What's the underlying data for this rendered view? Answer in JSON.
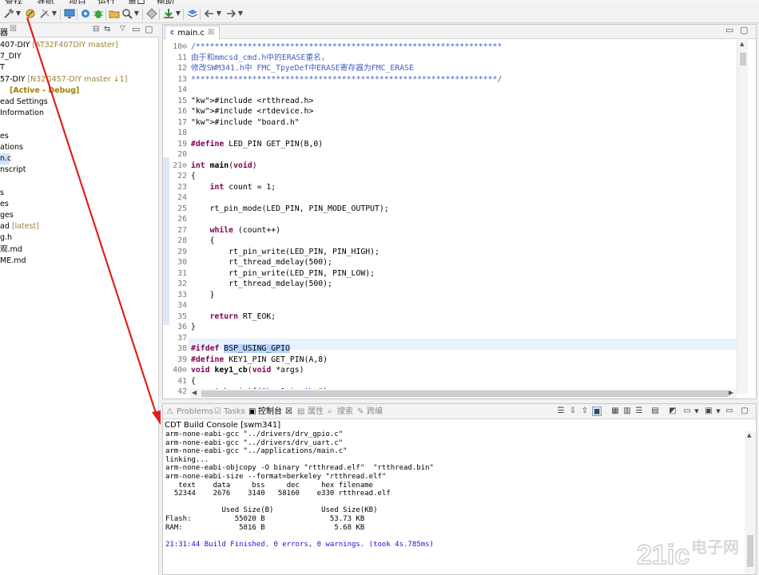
{
  "menubar": {
    "items": [
      "查找",
      "导航",
      "项目",
      "运行",
      "窗口",
      "帮助"
    ]
  },
  "toolbar": {
    "icons": [
      "hammer-icon",
      "build-icon",
      "tools-icon",
      "monitor-icon",
      "chip-icon",
      "bug-icon",
      "folder-icon",
      "search-icon",
      "diamond-icon",
      "download-icon",
      "layers-icon",
      "back-arrow-icon",
      "forward-arrow-icon"
    ]
  },
  "explorer": {
    "tab_label": "器",
    "rows": [
      {
        "text": "407-DIY",
        "extra": "[AT32F407DIY master]",
        "style": "dim"
      },
      {
        "text": "7_DIY",
        "extra": "",
        "style": ""
      },
      {
        "text": "T",
        "extra": "",
        "style": ""
      },
      {
        "text": "57-DIY",
        "extra": "[N32G457-DIY master ↓1]",
        "style": "dim"
      },
      {
        "text": "",
        "extra": "[Active - Debug]",
        "style": "green"
      },
      {
        "text": "ead Settings",
        "extra": "",
        "style": ""
      },
      {
        "text": "Information",
        "extra": "",
        "style": ""
      },
      {
        "text": "",
        "extra": "",
        "style": ""
      },
      {
        "text": "es",
        "extra": "",
        "style": ""
      },
      {
        "text": "ations",
        "extra": "",
        "style": ""
      },
      {
        "text": "n.c",
        "extra": "",
        "style": "sel"
      },
      {
        "text": "nscript",
        "extra": "",
        "style": ""
      },
      {
        "text": "",
        "extra": "",
        "style": ""
      },
      {
        "text": "s",
        "extra": "",
        "style": ""
      },
      {
        "text": "es",
        "extra": "",
        "style": ""
      },
      {
        "text": "ges",
        "extra": "",
        "style": ""
      },
      {
        "text": "ad",
        "extra": "[latest]",
        "style": "dim"
      },
      {
        "text": "g.h",
        "extra": "",
        "style": ""
      },
      {
        "text": "观.md",
        "extra": "",
        "style": ""
      },
      {
        "text": "ME.md",
        "extra": "",
        "style": ""
      }
    ]
  },
  "editor": {
    "tab_label": "main.c",
    "lines": [
      {
        "n": "10⊖",
        "code": "/*****************************************************************",
        "cls": "cm"
      },
      {
        "n": "11",
        "code": "由于和mmcsd_cmd.h中的ERASE重名，",
        "cls": "cm"
      },
      {
        "n": "12",
        "code": "修改SWM341.h中 FMC_TpyeDef中ERASE寄存器为FMC_ERASE",
        "cls": "cm"
      },
      {
        "n": "13",
        "code": "*****************************************************************/",
        "cls": "cm"
      },
      {
        "n": "14",
        "code": "",
        "cls": ""
      },
      {
        "n": "15",
        "code": "#include <rtthread.h>",
        "cls": "inc"
      },
      {
        "n": "16",
        "code": "#include <rtdevice.h>",
        "cls": "inc"
      },
      {
        "n": "17",
        "code": "#include \"board.h\"",
        "cls": "inc"
      },
      {
        "n": "18",
        "code": "",
        "cls": ""
      },
      {
        "n": "19",
        "code": "#define LED_PIN GET_PIN(B,0)",
        "cls": "def"
      },
      {
        "n": "20",
        "code": "",
        "cls": ""
      },
      {
        "n": "21⊖",
        "code": "int main(void)",
        "cls": "fn"
      },
      {
        "n": "22",
        "code": "{",
        "cls": ""
      },
      {
        "n": "23",
        "code": "    int count = 1;",
        "cls": "int"
      },
      {
        "n": "24",
        "code": "",
        "cls": ""
      },
      {
        "n": "25",
        "code": "    rt_pin_mode(LED_PIN, PIN_MODE_OUTPUT);",
        "cls": ""
      },
      {
        "n": "26",
        "code": "",
        "cls": ""
      },
      {
        "n": "27",
        "code": "    while (count++)",
        "cls": "while"
      },
      {
        "n": "28",
        "code": "    {",
        "cls": ""
      },
      {
        "n": "29",
        "code": "        rt_pin_write(LED_PIN, PIN_HIGH);",
        "cls": ""
      },
      {
        "n": "30",
        "code": "        rt_thread_mdelay(500);",
        "cls": ""
      },
      {
        "n": "31",
        "code": "        rt_pin_write(LED_PIN, PIN_LOW);",
        "cls": ""
      },
      {
        "n": "32",
        "code": "        rt_thread_mdelay(500);",
        "cls": ""
      },
      {
        "n": "33",
        "code": "    }",
        "cls": ""
      },
      {
        "n": "34",
        "code": "",
        "cls": ""
      },
      {
        "n": "35",
        "code": "    return RT_EOK;",
        "cls": "ret"
      },
      {
        "n": "36",
        "code": "}",
        "cls": ""
      },
      {
        "n": "37",
        "code": "",
        "cls": ""
      },
      {
        "n": "38",
        "code": "#ifdef BSP_USING_GPIO",
        "cls": "ifdef"
      },
      {
        "n": "39",
        "code": "#define KEY1_PIN GET_PIN(A,8)",
        "cls": "def"
      },
      {
        "n": "40⊖",
        "code": "void key1_cb(void *args)",
        "cls": "void"
      },
      {
        "n": "41",
        "code": "{",
        "cls": ""
      },
      {
        "n": "42",
        "code": "    rt_kprintf(\"key1_irq!\\n\");",
        "cls": "printf"
      }
    ]
  },
  "console": {
    "tabs": [
      {
        "label": "Problems",
        "active": false
      },
      {
        "label": "Tasks",
        "active": false
      },
      {
        "label": "控制台",
        "active": true
      },
      {
        "label": "属性",
        "active": false
      },
      {
        "label": "搜索",
        "active": false
      },
      {
        "label": "跨编",
        "active": false
      }
    ],
    "title": "CDT Build Console [swm341]",
    "lines": [
      "arm-none-eabi-gcc \"../drivers/drv_gpio.c\"",
      "arm-none-eabi-gcc \"../drivers/drv_uart.c\"",
      "arm-none-eabi-gcc \"../applications/main.c\"",
      "linking...",
      "arm-none-eabi-objcopy -O binary \"rtthread.elf\"  \"rtthread.bin\"",
      "arm-none-eabi-size --format=berkeley \"rtthread.elf\"",
      "   text    data     bss     dec     hex filename",
      "  52344    2676    3140   58160    e330 rtthread.elf",
      "",
      "             Used Size(B)           Used Size(KB)",
      "Flash:          55020 B               53.73 KB",
      "RAM:             5816 B                5.68 KB",
      "",
      "21:31:44 Build Finished. 0 errors, 0 warnings. (took 4s.785ms)"
    ]
  },
  "watermark": {
    "text": "21ic电子网"
  },
  "colors": {
    "arrow": "#e02020",
    "keyword": "#7f0055",
    "string": "#2a00ff",
    "comment": "#3f5fbf",
    "selection": "#b5d5ff"
  }
}
